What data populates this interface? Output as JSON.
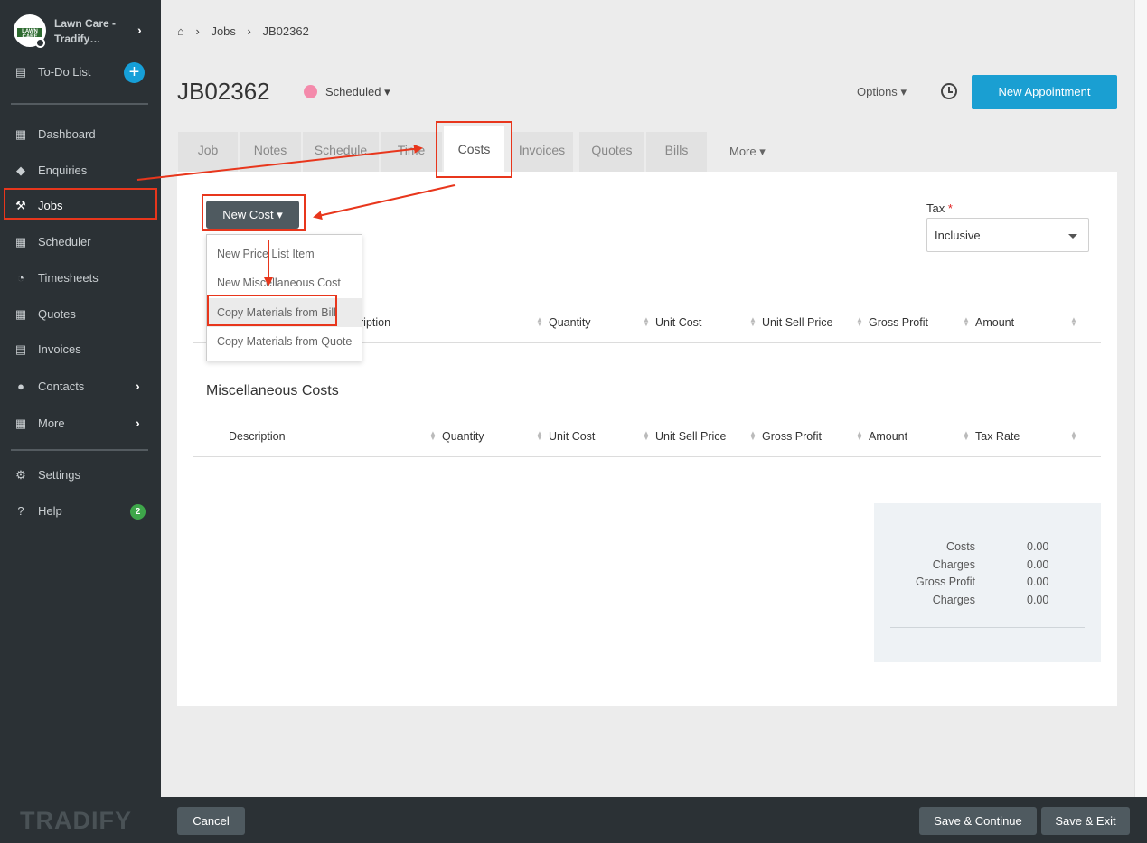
{
  "sidebar": {
    "org_name": "Lawn Care - Tradify…",
    "logo_text": "LAWN CARE",
    "items": [
      {
        "label": "To-Do List",
        "icon": "list-icon"
      },
      {
        "label": "Dashboard",
        "icon": "dashboard-icon"
      },
      {
        "label": "Enquiries",
        "icon": "tags-icon"
      },
      {
        "label": "Jobs",
        "icon": "hammer-icon"
      },
      {
        "label": "Scheduler",
        "icon": "calendar-icon"
      },
      {
        "label": "Timesheets",
        "icon": "clock-icon"
      },
      {
        "label": "Quotes",
        "icon": "calculator-icon"
      },
      {
        "label": "Invoices",
        "icon": "document-icon"
      },
      {
        "label": "Contacts",
        "icon": "users-icon"
      },
      {
        "label": "More",
        "icon": "grid-icon"
      },
      {
        "label": "Settings",
        "icon": "gear-icon"
      },
      {
        "label": "Help",
        "icon": "question-icon"
      }
    ],
    "help_badge": "2",
    "brand": "TRADIFY"
  },
  "breadcrumb": [
    "Jobs",
    "JB02362"
  ],
  "job": {
    "title": "JB02362",
    "status": "Scheduled",
    "status_color": "#f48aab",
    "options_label": "Options",
    "new_appointment_label": "New Appointment"
  },
  "tabs": [
    "Job",
    "Notes",
    "Schedule",
    "Time",
    "Costs",
    "Invoices",
    "Quotes",
    "Bills"
  ],
  "tab_more": "More",
  "costs": {
    "new_cost_label": "New Cost",
    "menu": [
      "New Price List Item",
      "New Miscellaneous Cost",
      "Copy Materials from Bill",
      "Copy Materials from Quote"
    ],
    "tax_label": "Tax",
    "tax_required": "*",
    "tax_value": "Inclusive",
    "materials_headers": [
      "ription",
      "Quantity",
      "Unit Cost",
      "Unit Sell Price",
      "Gross Profit",
      "Amount"
    ],
    "misc_title": "Miscellaneous Costs",
    "misc_headers": [
      "Description",
      "Quantity",
      "Unit Cost",
      "Unit Sell Price",
      "Gross Profit",
      "Amount",
      "Tax Rate"
    ]
  },
  "summary": [
    {
      "label": "Costs",
      "value": "0.00"
    },
    {
      "label": "Charges",
      "value": "0.00"
    },
    {
      "label": "Gross Profit",
      "value": "0.00"
    },
    {
      "label": "Charges",
      "value": "0.00"
    }
  ],
  "footer": {
    "cancel": "Cancel",
    "save_continue": "Save & Continue",
    "save_exit": "Save & Exit"
  },
  "colors": {
    "accent": "#1a9fd2",
    "sidebar": "#2b3135",
    "annotation": "#e8361c"
  }
}
